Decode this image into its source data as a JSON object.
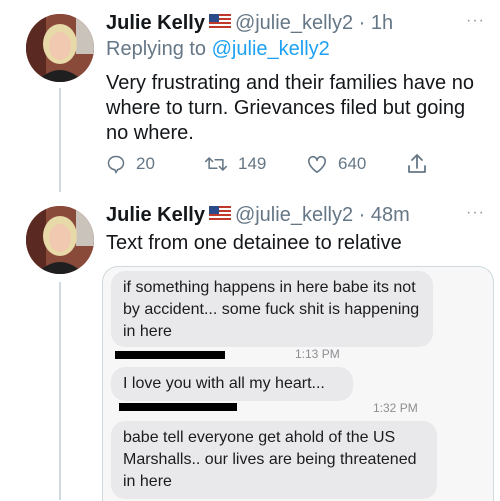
{
  "tweet1": {
    "name": "Julie Kelly",
    "handle_time": "@julie_kelly2 · 1h",
    "replying_prefix": "Replying to ",
    "replying_handle": "@julie_kelly2",
    "text": "Very frustrating and their families have no where to turn. Grievances filed but going no where.",
    "replies": "20",
    "retweets": "149",
    "likes": "640",
    "more": "···"
  },
  "tweet2": {
    "name": "Julie Kelly",
    "handle_time": "@julie_kelly2 · 48m",
    "text": "Text from one detainee to relative",
    "more": "···"
  },
  "messages": {
    "msg1": "if something happens in here babe its not by accident... some fuck shit is happening in here",
    "time1": "1:13 PM",
    "msg2": "I love you with all my heart...",
    "time2": "1:32 PM",
    "msg3": "babe tell everyone get ahold of the US Marshalls.. our lives are being threatened in here"
  },
  "colors": {
    "accent": "#1da1f2",
    "secondary_text": "#657786",
    "bubble": "#e9e9eb"
  }
}
